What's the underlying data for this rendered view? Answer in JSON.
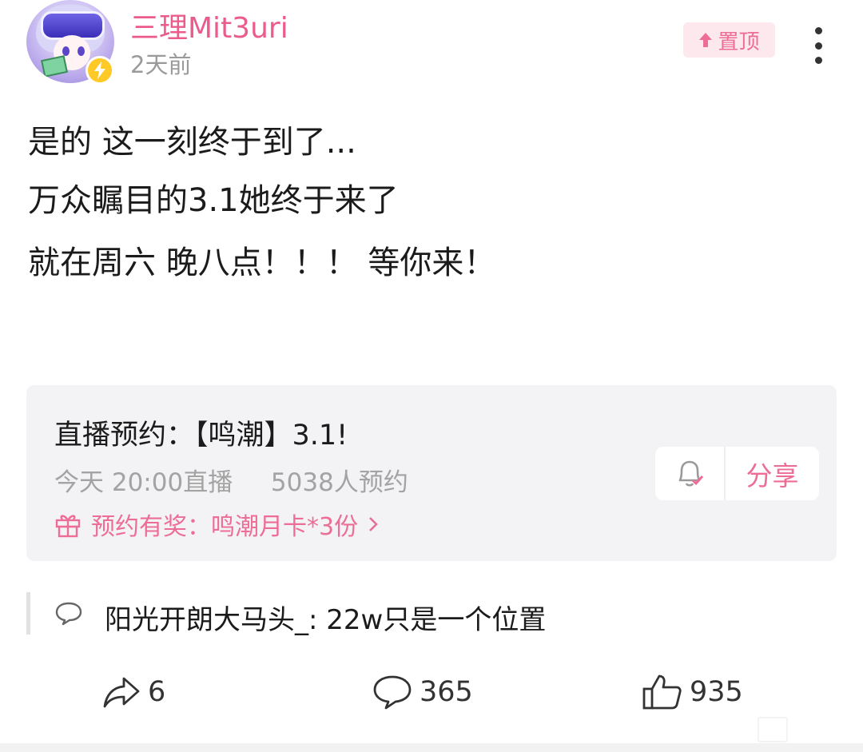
{
  "header": {
    "username": "三理Mit3uri",
    "time": "2天前",
    "pin_label": "置顶"
  },
  "post": {
    "lines": [
      "是的 这一刻终于到了...",
      "万众瞩目的3.1她终于来了",
      "就在周六 晚八点！！！ 等你来！"
    ]
  },
  "live_card": {
    "title": "直播预约：【鸣潮】3.1!",
    "schedule": "今天 20:00直播",
    "reservations": "5038人预约",
    "reward": "预约有奖：鸣潮月卡*3份",
    "share_label": "分享"
  },
  "comment_preview": {
    "text": "阳光开朗大马头_: 22w只是一个位置"
  },
  "stats": {
    "shares": "6",
    "comments": "365",
    "likes": "935"
  },
  "colors": {
    "accent_pink": "#ec5b8e",
    "pin_bg": "#fde8ee",
    "badge_yellow": "#ffc928",
    "card_bg": "#f3f3f5"
  },
  "icons": [
    "lightning-badge-icon",
    "pin-up-arrow-icon",
    "more-vertical-icon",
    "bell-check-icon",
    "gift-icon",
    "chevron-right-icon",
    "comment-bubble-icon",
    "share-arrow-icon",
    "like-thumb-icon"
  ]
}
